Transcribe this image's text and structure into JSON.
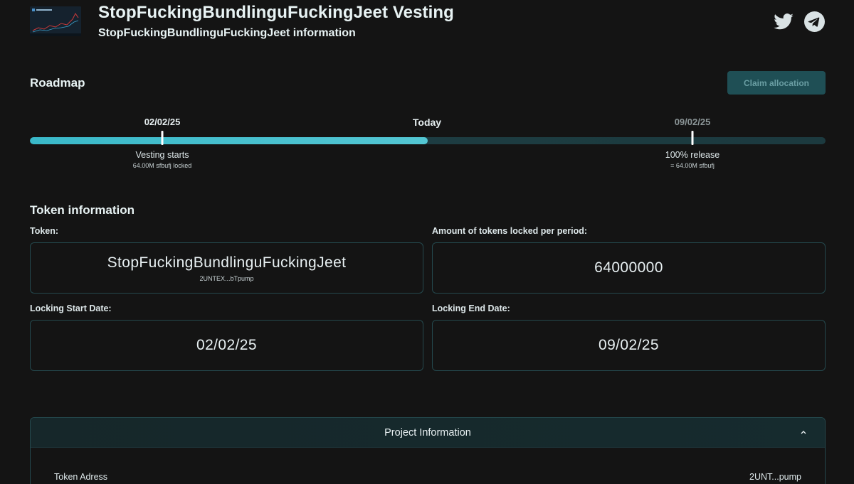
{
  "header": {
    "title": "StopFuckingBundlinguFuckingJeet Vesting",
    "subtitle": "StopFuckingBundlinguFuckingJeet information",
    "logo_icon": "chart-thumbnail-icon",
    "social": [
      {
        "icon": "twitter-icon"
      },
      {
        "icon": "telegram-icon"
      }
    ]
  },
  "roadmap": {
    "title": "Roadmap",
    "claim_button": "Claim allocation",
    "start_date": "02/02/25",
    "today_label": "Today",
    "end_date": "09/02/25",
    "progress_fraction": 0.5,
    "start_label": "Vesting starts",
    "start_sub": "64.00M sfbufj locked",
    "end_label": "100% release",
    "end_sub": "= 64.00M sfbufj"
  },
  "token_info": {
    "title": "Token information",
    "token_label": "Token:",
    "token_name": "StopFuckingBundlinguFuckingJeet",
    "token_address_short": "2UNTEX...bTpump",
    "amount_label": "Amount of tokens locked per period:",
    "amount_value": "64000000",
    "start_date_label": "Locking Start Date:",
    "start_date_value": "02/02/25",
    "end_date_label": "Locking End Date:",
    "end_date_value": "09/02/25"
  },
  "project": {
    "title": "Project Information",
    "chevron_icon": "chevron-up-icon",
    "token_address_label": "Token Adress",
    "token_address_value": "2UNT...pump"
  },
  "colors": {
    "accent": "#3ab9c9",
    "background": "#141414",
    "border": "#24484d",
    "button_bg": "#1f4f55"
  }
}
